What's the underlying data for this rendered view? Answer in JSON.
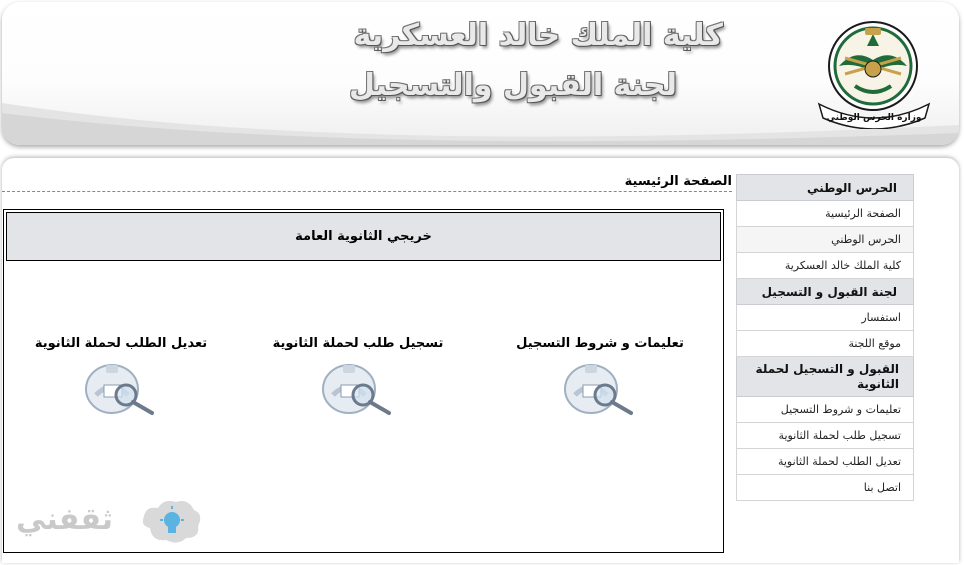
{
  "header": {
    "title": "كلية الملك خالد العسكرية",
    "subtitle": "لجنة القبول والتسجيل",
    "emblem_caption": "وزارة الحرس الوطني"
  },
  "page_title": "الصفحة الرئيسية",
  "sidebar": {
    "sections": [
      {
        "heading": "الحرس الوطني",
        "items": [
          "الصفحة الرئيسية",
          "الحرس الوطني",
          "كلية الملك خالد العسكرية"
        ]
      },
      {
        "heading": "لجنة القبول و التسجيل",
        "items": [
          "استفسار",
          "موقع اللجنة"
        ]
      },
      {
        "heading": "القبول و التسجيل لحملة الثانوية",
        "items": [
          "تعليمات و شروط التسجيل",
          "تسجيل طلب لحملة الثانوية",
          "تعديل الطلب لحملة الثانوية",
          "اتصل بنا"
        ]
      }
    ]
  },
  "main": {
    "section_heading": "خريجي الثانوية العامة",
    "links": [
      {
        "label": "تعليمات و شروط التسجيل",
        "icon": "emblem-search-icon"
      },
      {
        "label": "تسجيل طلب لحملة الثانوية",
        "icon": "emblem-search-icon"
      },
      {
        "label": "تعديل الطلب لحملة الثانوية",
        "icon": "emblem-search-icon"
      }
    ]
  },
  "watermark": {
    "text": "ثقفني",
    "icon": "lightbulb-icon"
  },
  "colors": {
    "header_bg": "#ffffff",
    "panel_gray": "#e2e4e7",
    "emblem_green": "#1f6b3a",
    "emblem_gold": "#c7a24a"
  }
}
